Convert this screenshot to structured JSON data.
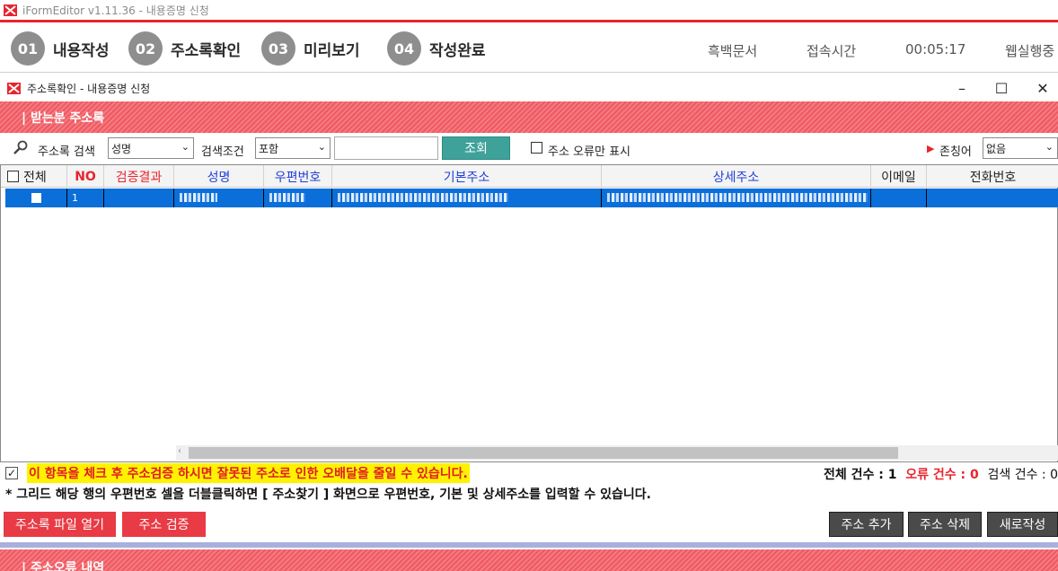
{
  "app": {
    "title": "iFormEditor v1.11.36 - 내용증명 신청"
  },
  "steps": [
    {
      "num": "01",
      "label": "내용작성"
    },
    {
      "num": "02",
      "label": "주소록확인"
    },
    {
      "num": "03",
      "label": "미리보기"
    },
    {
      "num": "04",
      "label": "작성완료"
    }
  ],
  "header_right": {
    "doc_type": "흑백문서",
    "conn_label": "접속시간",
    "conn_time": "00:05:17",
    "web_label": "웹실행중"
  },
  "dialog": {
    "title": "주소록확인 - 내용증명 신청",
    "minimize": "–",
    "maximize": "☐",
    "close": "✕"
  },
  "section1": {
    "title": "| 받는분 주소록"
  },
  "search": {
    "label": "주소록 검색",
    "field_value": "성명",
    "cond_label": "검색조건",
    "cond_value": "포함",
    "input_value": "",
    "search_button": "조회",
    "error_only_label": "주소 오류만 표시",
    "honorific_label": "존칭어",
    "honorific_value": "없음"
  },
  "grid": {
    "columns": {
      "all": "전체",
      "no": "NO",
      "verify": "검증결과",
      "name": "성명",
      "zip": "우편번호",
      "addr": "기본주소",
      "addr_detail": "상세주소",
      "email": "이메일",
      "phone": "전화번호"
    },
    "rows": [
      {
        "no": "1"
      }
    ]
  },
  "notice": {
    "text": "이 항목을 체크 후 주소검증 하시면 잘못된 주소로 인한 오배달을 줄일 수 있습니다"
  },
  "counts": {
    "total_label": "전체 건수 : 1",
    "error_label": "오류 건수 : 0",
    "search_label": "검색 건수 : 0"
  },
  "hint": "* 그리드 해당 행의 우편번호 셀을 더블클릭하면 [ 주소찾기 ] 화면으로 우편번호, 기본 및 상세주소를 입력할 수 있습니다.",
  "buttons": {
    "open_file": "주소록 파일 열기",
    "verify": "주소 검증",
    "add": "주소 추가",
    "delete": "주소 삭제",
    "new": "새로작성"
  },
  "section2": {
    "title": "| 주소오류 내역"
  },
  "colors": {
    "brand_red": "#e8242d",
    "band_red": "#ef5961",
    "row_blue": "#0a6fd8",
    "teal": "#3fa29a"
  }
}
